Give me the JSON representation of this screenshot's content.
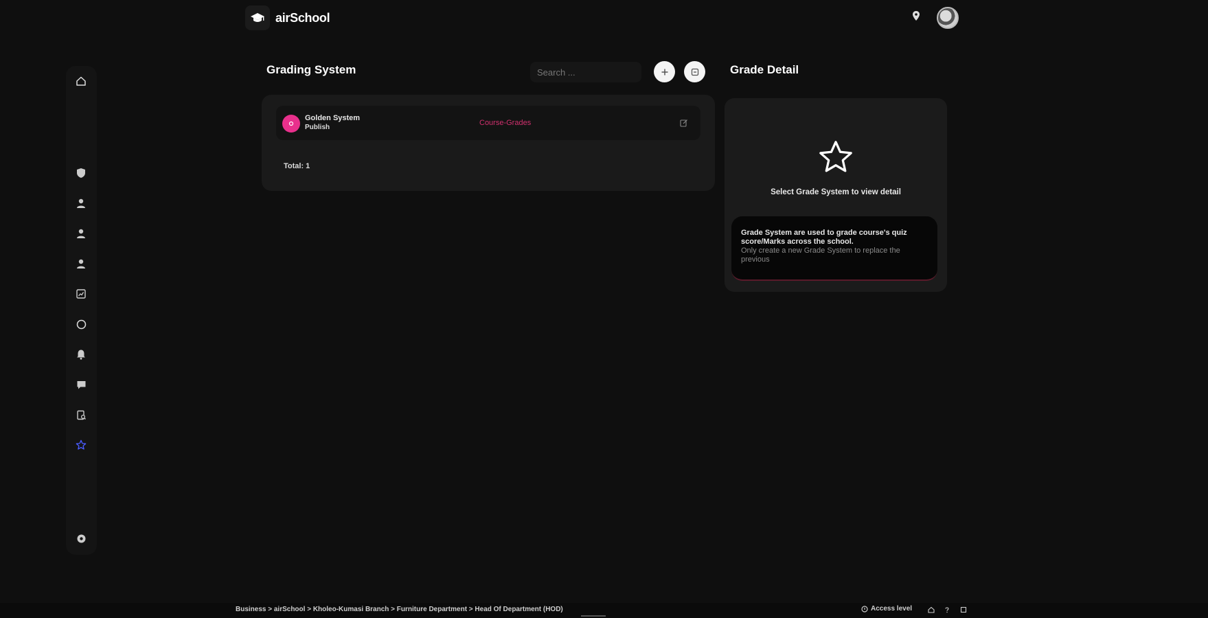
{
  "header": {
    "brand": "airSchool"
  },
  "page": {
    "title": "Grading System",
    "search_placeholder": "Search ..."
  },
  "list": {
    "items": [
      {
        "name": "Golden System",
        "status": "Publish",
        "tag": "Course-Grades"
      }
    ],
    "total_label": "Total: 1"
  },
  "detail": {
    "title": "Grade Detail",
    "select_message": "Select Grade System to view detail",
    "info_main": "Grade System are used to grade course's quiz score/Marks across the school.",
    "info_sub": "Only create a new Grade System to replace the previous"
  },
  "statusbar": {
    "breadcrumb": "Business > airSchool > Kholeo-Kumasi Branch > Furniture Department > Head Of Department (HOD)",
    "access_level": "Access level"
  },
  "colors": {
    "background": "#0f0f0f",
    "panel": "#1a1a1a",
    "accent_pink": "#e8308c",
    "active_nav": "#4a5cff"
  },
  "icons": {
    "sidebar": [
      "home-icon",
      "shield-icon",
      "user-icon",
      "user-icon",
      "user-icon",
      "chart-icon",
      "clock-icon",
      "bell-icon",
      "chat-icon",
      "document-search-icon",
      "star-icon",
      "settings-icon"
    ],
    "header": [
      "location-pin-icon",
      "avatar"
    ],
    "actions": [
      "plus-icon",
      "export-icon"
    ]
  }
}
